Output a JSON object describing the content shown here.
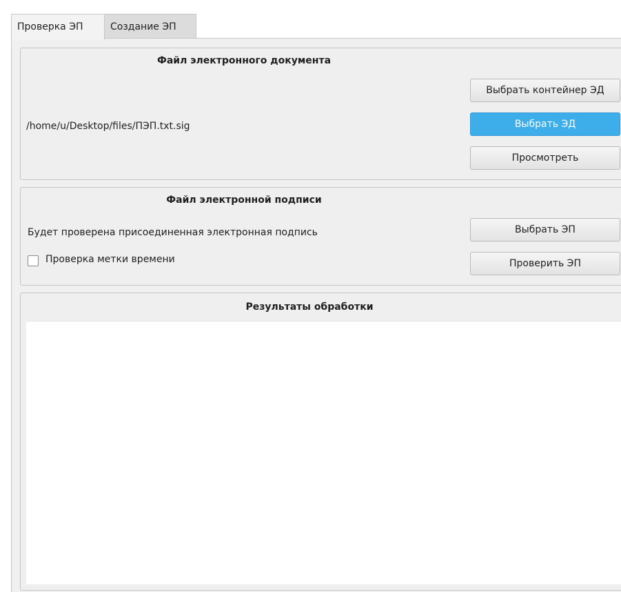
{
  "tabs": [
    {
      "label": "Проверка ЭП",
      "active": true
    },
    {
      "label": "Создание ЭП",
      "active": false
    }
  ],
  "doc_group": {
    "title": "Файл электронного документа",
    "path": "/home/u/Desktop/files/ПЭП.txt.sig",
    "btn_container": "Выбрать контейнер ЭД",
    "btn_select": "Выбрать ЭД",
    "btn_view": "Просмотреть"
  },
  "sig_group": {
    "title": "Файл электронной подписи",
    "info": "Будет проверена присоединенная электронная подпись",
    "timestamp_check_label": "Проверка метки времени",
    "timestamp_checked": false,
    "btn_select": "Выбрать ЭП",
    "btn_verify": "Проверить ЭП"
  },
  "results_group": {
    "title": "Результаты обработки",
    "content": ""
  },
  "colors": {
    "accent": "#3daee9",
    "panel": "#efefef"
  }
}
